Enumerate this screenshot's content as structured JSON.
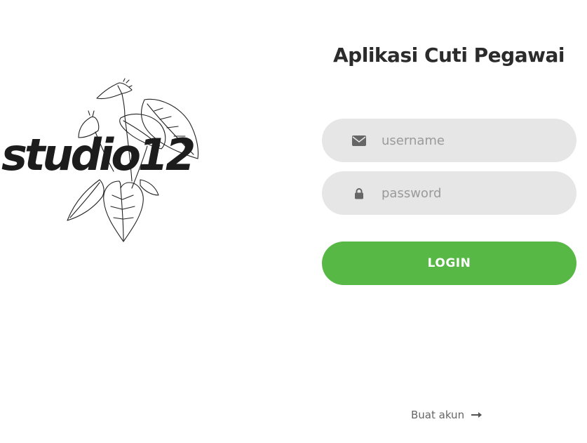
{
  "logo": {
    "wordmark": "studio12"
  },
  "form": {
    "title": "Aplikasi Cuti Pegawai",
    "username": {
      "placeholder": "username",
      "value": "",
      "icon": "envelope-icon"
    },
    "password": {
      "placeholder": "password",
      "value": "",
      "icon": "lock-icon"
    },
    "login_label": "LOGIN",
    "create_account_label": "Buat akun",
    "create_account_icon": "arrow-right-icon"
  },
  "colors": {
    "accent": "#57b846",
    "field_bg": "#e6e6e6",
    "title": "#2b2b2b",
    "placeholder": "#9a9a9a",
    "icon": "#666666"
  }
}
